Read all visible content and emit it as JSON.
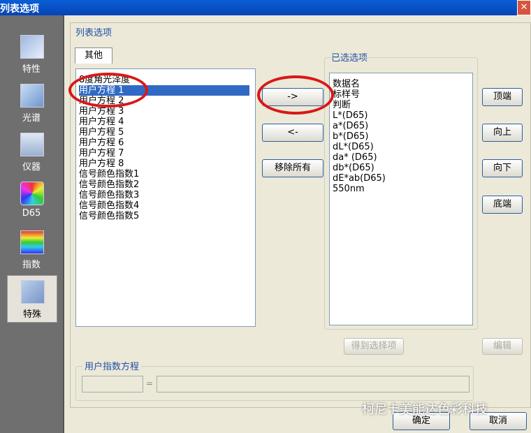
{
  "window": {
    "title": "列表选项",
    "close_glyph": "✕"
  },
  "sidebar": {
    "items": [
      {
        "label": "特性",
        "icon": "properties-icon"
      },
      {
        "label": "光谱",
        "icon": "spectrum-icon"
      },
      {
        "label": "仪器",
        "icon": "instrument-icon"
      },
      {
        "label": "D65",
        "icon": "color-wheel-icon"
      },
      {
        "label": "指数",
        "icon": "index-icon"
      },
      {
        "label": "特殊",
        "icon": "special-icon",
        "active": true
      }
    ]
  },
  "group_label": "列表选项",
  "left_tab": "其他",
  "left_list": [
    "8度角光泽度",
    "用户方程 1",
    "用户方程 2",
    "用户方程 3",
    "用户方程 4",
    "用户方程 5",
    "用户方程 6",
    "用户方程 7",
    "用户方程 8",
    "信号颜色指数1",
    "信号颜色指数2",
    "信号颜色指数3",
    "信号颜色指数4",
    "信号颜色指数5"
  ],
  "left_selected": "用户方程 1",
  "selected_label": "已选选项",
  "right_list": [
    "数据名",
    "标样号",
    "判断",
    "L*(D65)",
    "a*(D65)",
    "b*(D65)",
    "dL*(D65)",
    "da* (D65)",
    "db*(D65)",
    "dE*ab(D65)",
    "550nm"
  ],
  "buttons": {
    "add": "->",
    "remove": "<-",
    "remove_all": "移除所有",
    "top": "顶端",
    "up": "向上",
    "down": "向下",
    "bottom": "底端",
    "get_selected": "得到选择项",
    "edit": "编辑",
    "ok": "确定",
    "cancel": "取消"
  },
  "equation_group": {
    "label": "用户指数方程",
    "equals": "="
  },
  "watermark": "柯尼卡美能达色彩科技",
  "colors": {
    "selection": "#316ac5",
    "highlight_circle": "#d81818"
  }
}
